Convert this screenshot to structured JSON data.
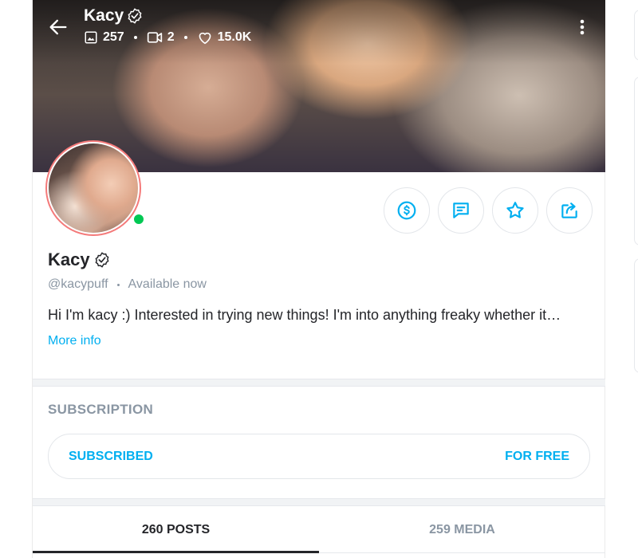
{
  "header": {
    "name": "Kacy",
    "stats": {
      "photos": "257",
      "videos": "2",
      "likes": "15.0K"
    }
  },
  "actions": [
    "tip",
    "message",
    "favorite",
    "share"
  ],
  "profile": {
    "name": "Kacy",
    "handle": "@kacypuff",
    "availability": "Available now",
    "bio": "Hi I'm kacy :) Interested in trying new things! I'm into anything freaky whether it…",
    "more_info": "More info"
  },
  "subscription": {
    "title": "SUBSCRIPTION",
    "status": "SUBSCRIBED",
    "price": "FOR FREE"
  },
  "tabs": [
    {
      "label": "260 POSTS",
      "active": true
    },
    {
      "label": "259 MEDIA",
      "active": false
    }
  ],
  "colors": {
    "accent": "#00aff0",
    "online": "#00c853",
    "text": "#242529",
    "muted": "#8a96a3"
  }
}
